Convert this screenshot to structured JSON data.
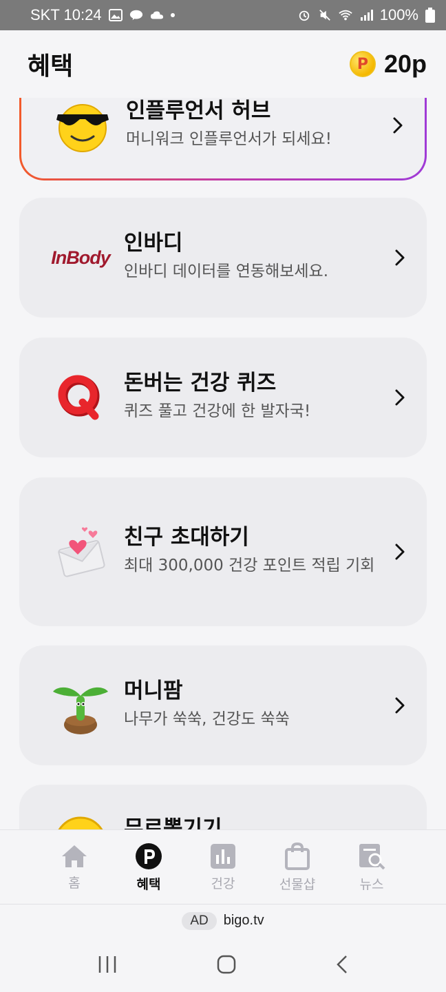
{
  "status": {
    "carrier_time": "SKT 10:24",
    "battery": "100%"
  },
  "header": {
    "title": "혜택",
    "points": "20p",
    "coin_letter": "P"
  },
  "cards": [
    {
      "title": "인플루언서 허브",
      "subtitle": "머니워크 인플루언서가 되세요!",
      "icon": "sunglasses-emoji-icon"
    },
    {
      "title": "인바디",
      "subtitle": "인바디 데이터를 연동해보세요.",
      "icon": "inbody-logo",
      "logo_text": "InBody"
    },
    {
      "title": "돈버는 건강 퀴즈",
      "subtitle": "퀴즈 풀고 건강에 한 발자국!",
      "icon": "quiz-q-icon"
    },
    {
      "title": "친구 초대하기",
      "subtitle": "최대 300,000 건강 포인트 적립 기회",
      "icon": "love-letter-icon"
    },
    {
      "title": "머니팜",
      "subtitle": "나무가 쑥쑥, 건강도 쑥쑥",
      "icon": "sprout-icon"
    },
    {
      "title": "무료뽑기기",
      "subtitle": "",
      "icon": "coin-icon"
    }
  ],
  "bottom_nav": [
    {
      "label": "홈",
      "icon": "home-icon",
      "active": false
    },
    {
      "label": "혜택",
      "icon": "points-icon",
      "active": true
    },
    {
      "label": "건강",
      "icon": "chart-icon",
      "active": false
    },
    {
      "label": "선물샵",
      "icon": "shopping-bag-icon",
      "active": false
    },
    {
      "label": "뉴스",
      "icon": "news-search-icon",
      "active": false
    }
  ],
  "ad": {
    "tag": "AD",
    "text": "bigo.tv"
  },
  "colors": {
    "accent_gradient_start": "#f25a2a",
    "accent_gradient_end": "#a03ad6",
    "card_bg": "#ececef"
  }
}
